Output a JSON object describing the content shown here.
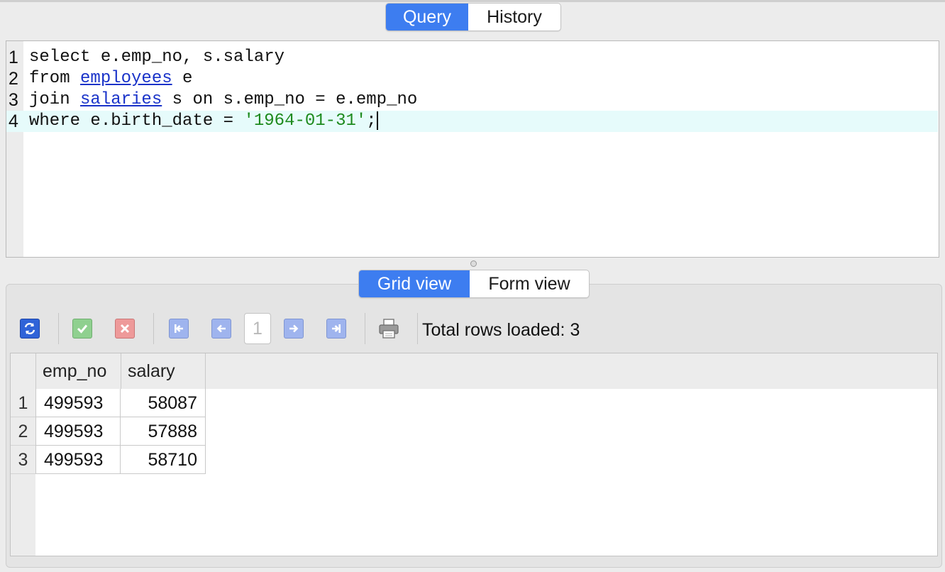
{
  "query_tabs": [
    {
      "label": "Query",
      "active": true
    },
    {
      "label": "History",
      "active": false
    }
  ],
  "editor": {
    "lines": [
      {
        "num": "1",
        "parts": [
          {
            "t": "select e.emp_no, s.salary",
            "c": "plain"
          }
        ]
      },
      {
        "num": "2",
        "parts": [
          {
            "t": "from ",
            "c": "plain"
          },
          {
            "t": "employees",
            "c": "link"
          },
          {
            "t": " e",
            "c": "plain"
          }
        ]
      },
      {
        "num": "3",
        "parts": [
          {
            "t": "join ",
            "c": "plain"
          },
          {
            "t": "salaries",
            "c": "link"
          },
          {
            "t": " s on s.emp_no = e.emp_no",
            "c": "plain"
          }
        ]
      },
      {
        "num": "4",
        "parts": [
          {
            "t": "where e.birth_date = ",
            "c": "plain"
          },
          {
            "t": "'1964-01-31'",
            "c": "string"
          },
          {
            "t": ";",
            "c": "plain"
          }
        ],
        "current": true
      }
    ],
    "colors": {
      "link": "#1a33c9",
      "string": "#1d8a1d",
      "current_line_bg": "#e6fbfb"
    }
  },
  "results_tabs": [
    {
      "label": "Grid view",
      "active": true
    },
    {
      "label": "Form view",
      "active": false
    }
  ],
  "toolbar": {
    "buttons": [
      "refresh-icon",
      "apply-changes-icon",
      "discard-changes-icon",
      "first-page-icon",
      "prev-page-icon",
      "next-page-icon",
      "last-page-icon",
      "print-icon"
    ],
    "page": "1",
    "rows_loaded": "Total rows loaded: 3"
  },
  "grid": {
    "columns": [
      "emp_no",
      "salary"
    ],
    "rows": [
      {
        "num": "1",
        "emp_no": "499593",
        "salary": "58087"
      },
      {
        "num": "2",
        "emp_no": "499593",
        "salary": "57888"
      },
      {
        "num": "3",
        "emp_no": "499593",
        "salary": "58710"
      }
    ]
  },
  "accent_color": "#3d7df0"
}
